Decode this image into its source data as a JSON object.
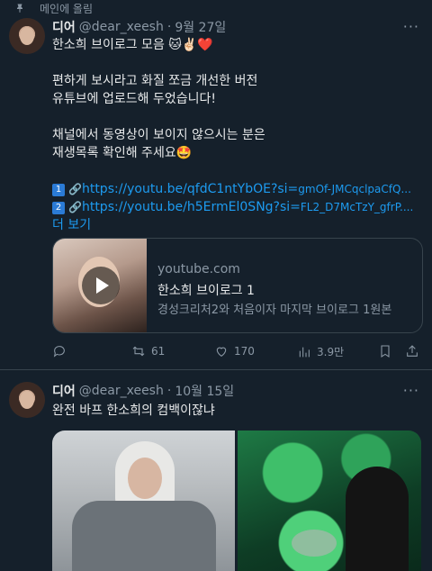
{
  "pinned": {
    "label": "메인에 올림"
  },
  "tweets": [
    {
      "name": "디어",
      "handle": "@dear_xeesh",
      "date": "9월 27일",
      "more": "···",
      "lines": [
        "한소희 브이로그 모음 🐱✌🏻❤️",
        "",
        "편하게 보시라고 화질 쪼금 개선한 버전",
        "유튜브에 업로드해 두었습니다!",
        "",
        "채널에서 동영상이 보이지 않으시는 분은",
        "재생목록 확인해 주세요🤩"
      ],
      "links": [
        {
          "num": "1",
          "emoji": "🔗",
          "url_main": "https://youtu.be/qfdC1ntYbOE?si=",
          "url_tail": "gmOf-JMCqclpaCfQ..."
        },
        {
          "num": "2",
          "emoji": "🔗",
          "url_main": "https://youtu.be/h5ErmEl0SNg?si=",
          "url_tail": "FL2_D7McTzY_gfrP...."
        }
      ],
      "show_more": "더 보기",
      "card": {
        "domain": "youtube.com",
        "title": "한소희 브이로그 1",
        "desc": "경성크리처2와 처음이자 마지막 브이로그 1원본"
      },
      "actions": {
        "retweets": "61",
        "likes": "170",
        "views": "3.9만"
      }
    },
    {
      "name": "디어",
      "handle": "@dear_xeesh",
      "date": "10월 15일",
      "more": "···",
      "text": "완전 바프 한소희의 컴백이잖냐"
    }
  ],
  "icons": [
    "pin-icon",
    "reply-icon",
    "retweet-icon",
    "like-icon",
    "views-icon",
    "bookmark-icon",
    "share-icon"
  ],
  "colors": {
    "background": "#15202b",
    "link": "#1d9bf0",
    "muted": "#8b98a5",
    "divider": "#38444d"
  }
}
